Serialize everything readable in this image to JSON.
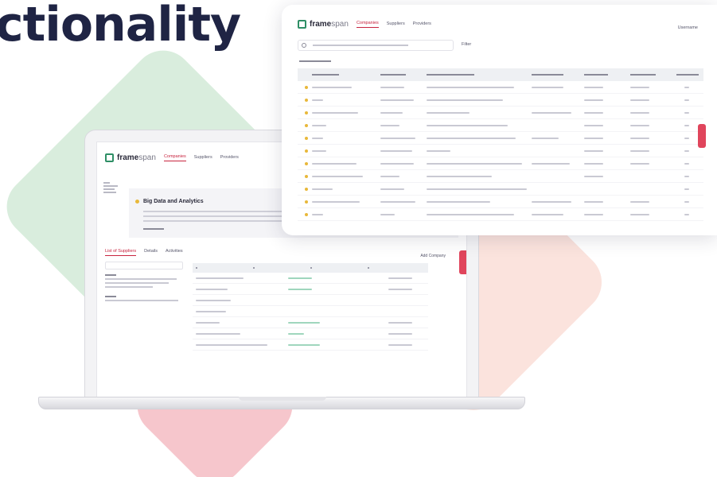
{
  "headline": "ctionality",
  "brand": {
    "name_bold": "frame",
    "name_light": "span"
  },
  "laptop": {
    "tabs": [
      "Companies",
      "Suppliers",
      "Providers"
    ],
    "banner_title": "Big Data and Analytics",
    "sub_tabs": [
      "List of Suppliers",
      "Details",
      "Activities"
    ],
    "action_label": "Add Company"
  },
  "panel": {
    "tabs": [
      "Companies",
      "Suppliers",
      "Providers"
    ],
    "user_label": "Username",
    "filter_label": "Filter"
  },
  "colors": {
    "accent": "#c8243f",
    "brand": "#2f8f66",
    "headline": "#1f2444"
  }
}
